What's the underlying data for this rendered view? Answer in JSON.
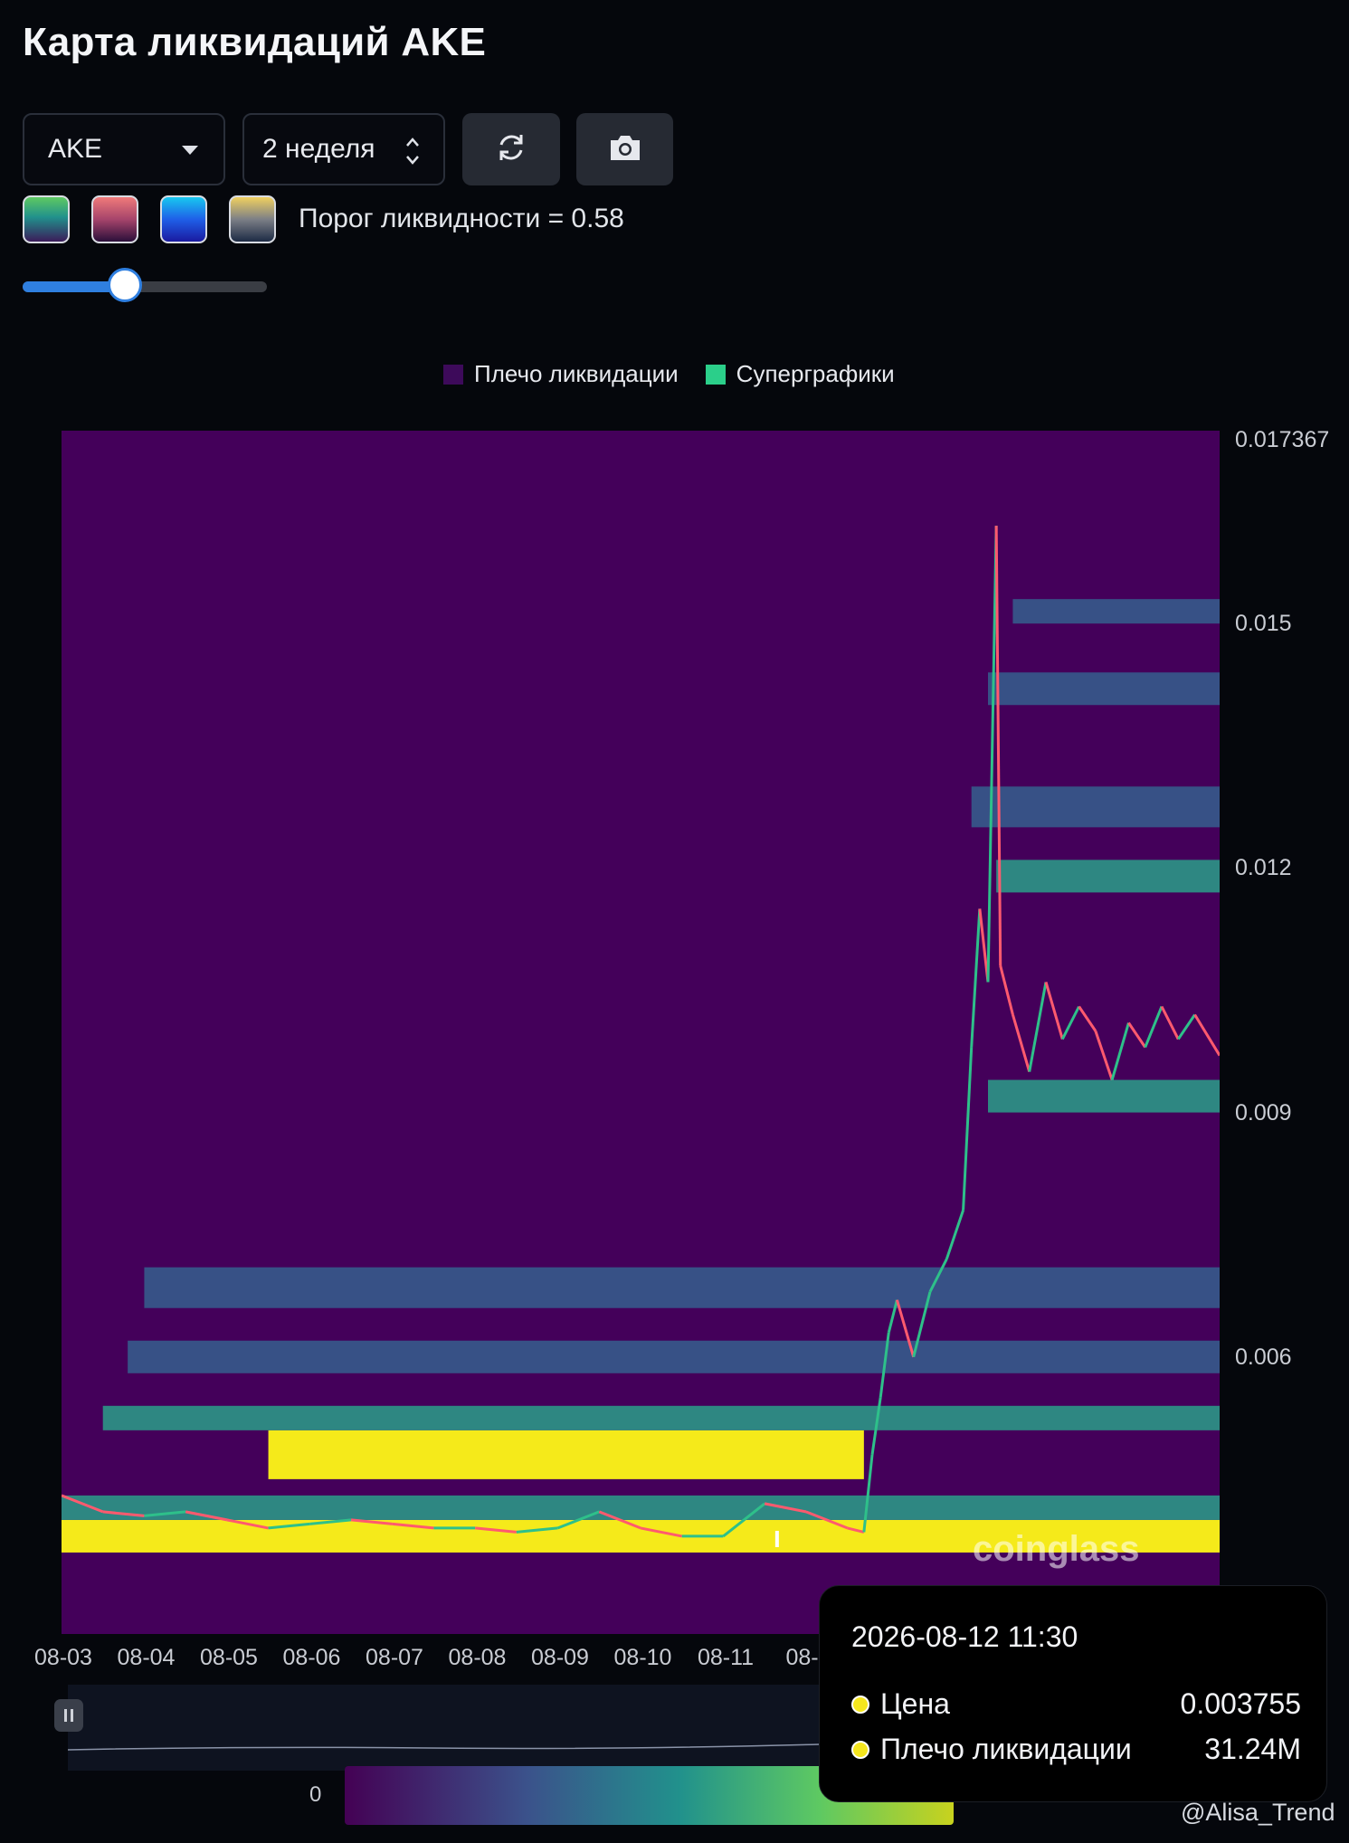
{
  "title": "Карта ликвидаций AKE",
  "controls": {
    "coin": "AKE",
    "period": "2 неделя",
    "refresh_icon": "refresh-icon",
    "camera_icon": "camera-icon"
  },
  "palettes": [
    {
      "name": "viridis",
      "top": "#5ec962",
      "bottom": "#3b1c5a"
    },
    {
      "name": "rose",
      "top": "#f07a7a",
      "bottom": "#2b0f3a"
    },
    {
      "name": "jet",
      "top": "#18c8f0",
      "bottom": "#1a1aa0"
    },
    {
      "name": "cividis",
      "top": "#f0d060",
      "bottom": "#1d2b45"
    }
  ],
  "threshold_label": "Порог ликвидности = 0.58",
  "threshold_value": 0.58,
  "legend": [
    {
      "label": "Плечо ликвидации",
      "color": "#3d0a5a"
    },
    {
      "label": "Суперграфики",
      "color": "#2bcf8a"
    }
  ],
  "colors": {
    "bg": "#44005a",
    "up": "#2ec08a",
    "down": "#ff5a6e",
    "bright": "#f5ea1a"
  },
  "watermark_brand": "coinglass",
  "watermark_author": "@Alisa_Trend",
  "tooltip": {
    "time": "2026-08-12 11:30",
    "price_label": "Цена",
    "price_value": "0.003755",
    "lev_label": "Плечо ликвидации",
    "lev_value": "31.24M"
  },
  "scale": {
    "min_label": "0"
  },
  "chart_data": {
    "type": "heatmap",
    "x_labels": [
      "08-03",
      "08-04",
      "08-05",
      "08-06",
      "08-07",
      "08-08",
      "08-09",
      "08-10",
      "08-11",
      "08-1"
    ],
    "y_ticks": [
      0.006,
      0.009,
      0.012,
      0.015,
      0.017367
    ],
    "y_tick_labels": [
      "0.006",
      "0.009",
      "0.012",
      "0.015",
      "0.017367"
    ],
    "ylim": [
      0.0026,
      0.017367
    ],
    "xlim": [
      0,
      14
    ],
    "bands": [
      {
        "y0": 0.0036,
        "y1": 0.004,
        "x0": 0,
        "x1": 14,
        "level": "bright"
      },
      {
        "y0": 0.0045,
        "y1": 0.0051,
        "x0": 2.5,
        "x1": 9.7,
        "level": "bright"
      },
      {
        "y0": 0.004,
        "y1": 0.0043,
        "x0": 0,
        "x1": 14,
        "level": "mid"
      },
      {
        "y0": 0.0051,
        "y1": 0.0054,
        "x0": 0.5,
        "x1": 14,
        "level": "mid"
      },
      {
        "y0": 0.0058,
        "y1": 0.0062,
        "x0": 0.8,
        "x1": 14,
        "level": "low"
      },
      {
        "y0": 0.0066,
        "y1": 0.0071,
        "x0": 1.0,
        "x1": 14,
        "level": "low"
      },
      {
        "y0": 0.009,
        "y1": 0.0094,
        "x0": 11.2,
        "x1": 14,
        "level": "mid"
      },
      {
        "y0": 0.0117,
        "y1": 0.0121,
        "x0": 11.3,
        "x1": 14,
        "level": "mid"
      },
      {
        "y0": 0.0125,
        "y1": 0.013,
        "x0": 11.0,
        "x1": 14,
        "level": "low"
      },
      {
        "y0": 0.014,
        "y1": 0.0144,
        "x0": 11.2,
        "x1": 14,
        "level": "low"
      },
      {
        "y0": 0.015,
        "y1": 0.0153,
        "x0": 11.5,
        "x1": 14,
        "level": "low"
      }
    ],
    "price_series": [
      [
        0,
        0.0043
      ],
      [
        0.5,
        0.0041
      ],
      [
        1,
        0.00405
      ],
      [
        1.5,
        0.0041
      ],
      [
        2,
        0.004
      ],
      [
        2.5,
        0.0039
      ],
      [
        3,
        0.00395
      ],
      [
        3.5,
        0.004
      ],
      [
        4,
        0.00395
      ],
      [
        4.5,
        0.0039
      ],
      [
        5,
        0.0039
      ],
      [
        5.5,
        0.00385
      ],
      [
        6,
        0.0039
      ],
      [
        6.5,
        0.0041
      ],
      [
        7,
        0.0039
      ],
      [
        7.5,
        0.0038
      ],
      [
        8,
        0.0038
      ],
      [
        8.5,
        0.0042
      ],
      [
        9,
        0.0041
      ],
      [
        9.5,
        0.0039
      ],
      [
        9.7,
        0.00385
      ],
      [
        9.8,
        0.0048
      ],
      [
        9.9,
        0.0055
      ],
      [
        10.0,
        0.0063
      ],
      [
        10.1,
        0.0067
      ],
      [
        10.3,
        0.006
      ],
      [
        10.5,
        0.0068
      ],
      [
        10.7,
        0.0072
      ],
      [
        10.9,
        0.0078
      ],
      [
        11.0,
        0.0098
      ],
      [
        11.1,
        0.0115
      ],
      [
        11.2,
        0.0106
      ],
      [
        11.3,
        0.0162
      ],
      [
        11.35,
        0.0108
      ],
      [
        11.5,
        0.0102
      ],
      [
        11.7,
        0.0095
      ],
      [
        11.9,
        0.0106
      ],
      [
        12.1,
        0.0099
      ],
      [
        12.3,
        0.0103
      ],
      [
        12.5,
        0.01
      ],
      [
        12.7,
        0.0094
      ],
      [
        12.9,
        0.0101
      ],
      [
        13.1,
        0.0098
      ],
      [
        13.3,
        0.0103
      ],
      [
        13.5,
        0.0099
      ],
      [
        13.7,
        0.0102
      ],
      [
        14,
        0.0097
      ]
    ],
    "highlight_point": {
      "x": 8.65,
      "y": 0.003755
    }
  }
}
